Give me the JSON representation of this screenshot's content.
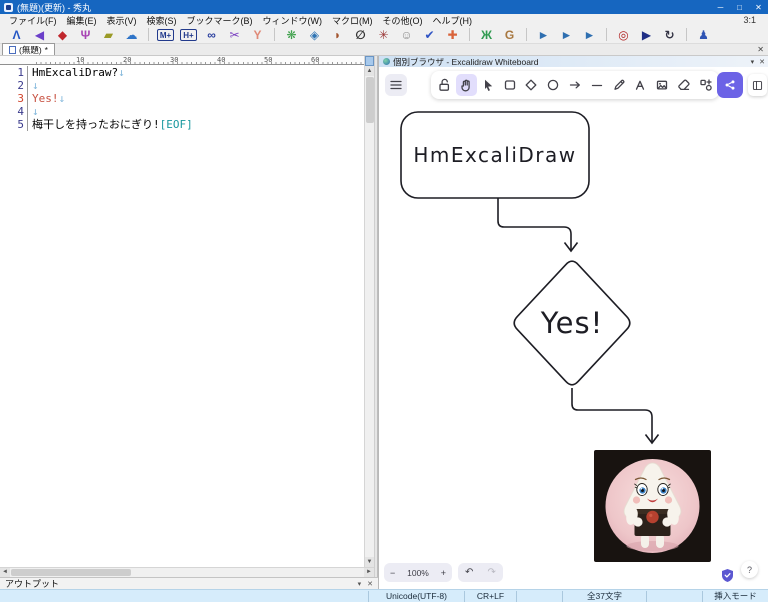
{
  "window": {
    "title": "(無題)(更新) - 秀丸",
    "minimize": "─",
    "maximize": "□",
    "close": "✕"
  },
  "menu": {
    "items": [
      {
        "name": "menu-file",
        "label": "ファイル(F)"
      },
      {
        "name": "menu-edit",
        "label": "編集(E)"
      },
      {
        "name": "menu-view",
        "label": "表示(V)"
      },
      {
        "name": "menu-search",
        "label": "検索(S)"
      },
      {
        "name": "menu-bookmark",
        "label": "ブックマーク(B)"
      },
      {
        "name": "menu-window",
        "label": "ウィンドウ(W)"
      },
      {
        "name": "menu-macro",
        "label": "マクロ(M)"
      },
      {
        "name": "menu-other",
        "label": "その他(O)"
      },
      {
        "name": "menu-help",
        "label": "ヘルプ(H)"
      }
    ],
    "caret_position": "3:1"
  },
  "toolbar": {
    "icons": [
      {
        "name": "caret-icon",
        "glyph": "Λ",
        "color": "#2456c4"
      },
      {
        "name": "purple-arrow-icon",
        "glyph": "◀",
        "color": "#6b3fc9"
      },
      {
        "name": "red-diamond-icon",
        "glyph": "◆",
        "color": "#c0272d"
      },
      {
        "name": "octopus-icon",
        "glyph": "Ψ",
        "color": "#a844b4"
      },
      {
        "name": "folder-icon",
        "glyph": "▰",
        "color": "#9a9a26"
      },
      {
        "name": "cloud-icon",
        "glyph": "☁",
        "color": "#2f74c8"
      },
      {
        "cls": "sep"
      },
      {
        "name": "m-plus-icon",
        "glyph": "M+",
        "color": "#223a8c",
        "cls": "boxed"
      },
      {
        "name": "h-plus-icon",
        "glyph": "H+",
        "color": "#223a8c",
        "cls": "boxed"
      },
      {
        "name": "oval-icon",
        "glyph": "∞",
        "color": "#2a3f9e"
      },
      {
        "name": "scissors-icon",
        "glyph": "✂",
        "color": "#7a3fc0"
      },
      {
        "name": "y-icon",
        "glyph": "Y",
        "color": "#e08a78"
      },
      {
        "cls": "sep"
      },
      {
        "name": "green-flower-icon",
        "glyph": "❋",
        "color": "#3da04a"
      },
      {
        "name": "blue-diamond-icon",
        "glyph": "◈",
        "color": "#2f74b4"
      },
      {
        "name": "brown-circle-icon",
        "glyph": "◗",
        "color": "#a2542e"
      },
      {
        "name": "compass-icon",
        "glyph": "∅",
        "color": "#333333"
      },
      {
        "name": "starburst-icon",
        "glyph": "✳",
        "color": "#993333"
      },
      {
        "name": "face-icon",
        "glyph": "☺",
        "color": "#8a8a8a"
      },
      {
        "name": "check-icon",
        "glyph": "✔",
        "color": "#2f54c4"
      },
      {
        "name": "plus-icon",
        "glyph": "✚",
        "color": "#d9633a"
      },
      {
        "cls": "sep"
      },
      {
        "name": "bug-icon",
        "glyph": "Ж",
        "color": "#2f9a50"
      },
      {
        "name": "g-icon",
        "glyph": "G",
        "color": "#a87840"
      },
      {
        "cls": "sep"
      },
      {
        "name": "boot-run-icon",
        "glyph": "►",
        "color": "#2e6fb0"
      },
      {
        "name": "boot-step-icon",
        "glyph": "►",
        "color": "#2e6fb0"
      },
      {
        "name": "boot-stop-icon",
        "glyph": "►",
        "color": "#2e6fb0"
      },
      {
        "cls": "sep"
      },
      {
        "name": "red-ring-icon",
        "glyph": "◎",
        "color": "#b02020"
      },
      {
        "name": "play-icon",
        "glyph": "▶",
        "color": "#1f2f86"
      },
      {
        "name": "reload-icon",
        "glyph": "↻",
        "color": "#333344"
      },
      {
        "cls": "sep"
      },
      {
        "name": "ant-icon",
        "glyph": "♟",
        "color": "#2f54b4"
      }
    ]
  },
  "tabbar": {
    "active_tab": "(無題)",
    "modified_mark": "*",
    "pane_close": "✕"
  },
  "editor": {
    "ruler_numbers": [
      {
        "n": "10"
      },
      {
        "n": "20"
      },
      {
        "n": "30"
      },
      {
        "n": "40"
      },
      {
        "n": "50"
      },
      {
        "n": "60"
      }
    ],
    "lines": [
      {
        "num": "1",
        "text": "HmExcaliDraw?",
        "mark": "↓"
      },
      {
        "num": "2",
        "text": "",
        "mark": "↓"
      },
      {
        "num": "3",
        "text": "Yes!",
        "mark": "↓",
        "cls": "edited"
      },
      {
        "num": "4",
        "text": "",
        "mark": "↓"
      },
      {
        "num": "5",
        "text": "梅干しを持ったおにぎり!",
        "mark": "[EOF]",
        "markcls": "eof"
      }
    ],
    "colors": {
      "line_number": "#3b3b8c",
      "edited_line_number": "#d0442c",
      "edited_text": "#c75040",
      "linebreak_mark": "#85b9dc",
      "eof_mark": "#18989e"
    }
  },
  "output": {
    "title": "アウトプット",
    "collapse": "▾",
    "close": "✕"
  },
  "status": {
    "encoding": "Unicode(UTF-8)",
    "eol": "CR+LF",
    "count": "全37文字",
    "mode": "挿入モード"
  },
  "pane": {
    "title": "個別ブラウザ - Excalidraw Whiteboard",
    "collapse": "▾",
    "close": "✕"
  },
  "excalidraw": {
    "tools": [
      "lock",
      "hand",
      "selection",
      "rectangle",
      "diamond",
      "ellipse",
      "arrow",
      "line",
      "draw",
      "text",
      "image",
      "eraser",
      "more-tools"
    ],
    "selected_tool": "hand",
    "canvas": {
      "rect_label": "HmExcaliDraw",
      "diamond_label": "Yes!"
    },
    "zoom": {
      "out": "−",
      "level": "100%",
      "in": "+",
      "undo": "↶",
      "redo": "↷",
      "help": "?"
    },
    "colors": {
      "accent": "#6c63e6",
      "selected_tool_bg": "#e2defc",
      "stroke": "#1d1d24"
    }
  }
}
